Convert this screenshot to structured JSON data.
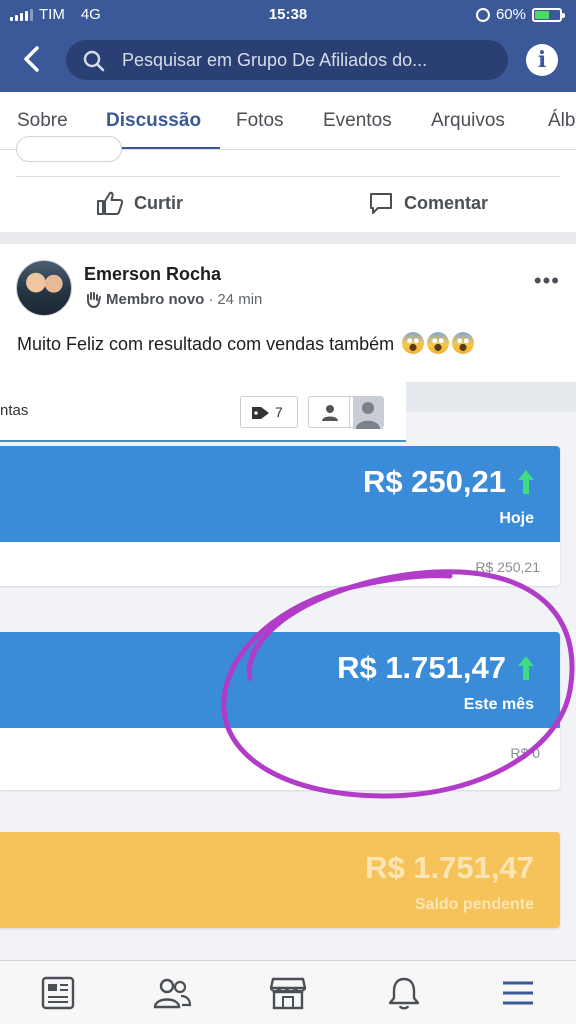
{
  "status": {
    "carrier": "TIM",
    "network": "4G",
    "time": "15:38",
    "battery_percent": "60%",
    "battery_level": 0.6
  },
  "header": {
    "search_placeholder": "Pesquisar em Grupo De Afiliados do..."
  },
  "tabs": [
    {
      "label": "Sobre"
    },
    {
      "label": "Discussão",
      "active": true
    },
    {
      "label": "Fotos"
    },
    {
      "label": "Eventos"
    },
    {
      "label": "Arquivos"
    },
    {
      "label": "Álb"
    }
  ],
  "prev_post": {
    "like_label": "Curtir",
    "comment_label": "Comentar"
  },
  "post": {
    "author": "Emerson Rocha",
    "role": "Membro novo",
    "time_ago": "24 min",
    "separator": "·",
    "text": "Muito Feliz com resultado com vendas também",
    "emoji_count": 3
  },
  "screenshot": {
    "header_label": "ntas",
    "tag_count": "7",
    "cards": [
      {
        "value": "R$ 250,21",
        "caption": "Hoje",
        "footer": "R$ 250,21",
        "color": "#3a8bd8"
      },
      {
        "value": "R$ 1.751,47",
        "caption": "Este mês",
        "footer": "R$ 0",
        "color": "#3a8bd8"
      },
      {
        "value": "R$ 1.751,47",
        "caption": "Saldo pendente",
        "color": "#f6c35a"
      }
    ],
    "arrow_color": "#3ddc84",
    "highlight_color": "#b03cc8"
  },
  "colors": {
    "facebook_blue": "#3b5998",
    "tab_active": "#3b5998"
  }
}
